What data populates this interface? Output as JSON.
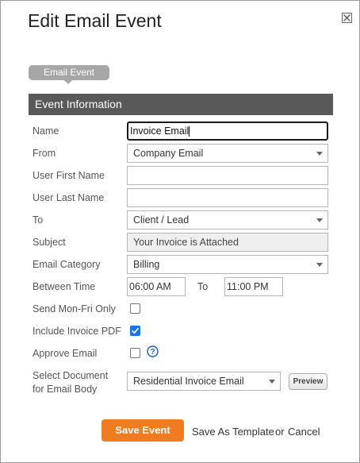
{
  "dialog": {
    "title": "Edit Email Event",
    "close_icon": "close-x-icon"
  },
  "tab": {
    "label": "Email Event"
  },
  "section": {
    "title": "Event Information"
  },
  "form": {
    "name": {
      "label": "Name",
      "value": "Invoice Email"
    },
    "from": {
      "label": "From",
      "value": "Company Email"
    },
    "user_first_name": {
      "label": "User First Name",
      "value": ""
    },
    "user_last_name": {
      "label": "User Last Name",
      "value": ""
    },
    "to": {
      "label": "To",
      "value": "Client / Lead"
    },
    "subject": {
      "label": "Subject",
      "value": "Your Invoice is Attached"
    },
    "email_category": {
      "label": "Email Category",
      "value": "Billing"
    },
    "between_time": {
      "label": "Between Time",
      "start": "06:00 AM",
      "to_label": "To",
      "end": "11:00 PM"
    },
    "send_mon_fri_only": {
      "label": "Send Mon-Fri Only",
      "checked": false
    },
    "include_invoice_pdf": {
      "label": "Include Invoice PDF",
      "checked": true
    },
    "approve_email": {
      "label": "Approve Email",
      "checked": false,
      "help_icon": "question-circle-icon"
    },
    "select_document": {
      "label_line1": "Select Document",
      "label_line2": "for Email Body",
      "value": "Residential Invoice Email",
      "preview_label": "Preview"
    }
  },
  "footer": {
    "save_label": "Save Event",
    "save_template_label": "Save As Template",
    "or_text": "or",
    "cancel_label": "Cancel"
  },
  "colors": {
    "section_header_bg": "#595959",
    "tab_bg": "#a6a6a6",
    "save_button_bg": "#f07c1f",
    "checkbox_checked": "#1a73e8"
  }
}
